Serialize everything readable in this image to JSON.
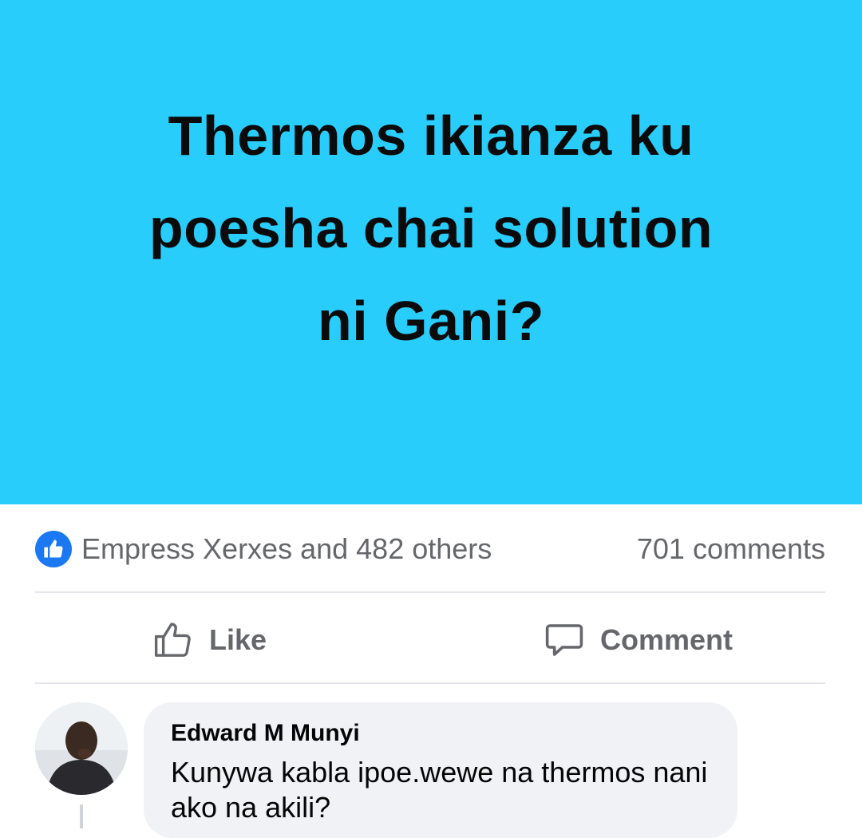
{
  "post": {
    "text_lines": [
      "Thermos ikianza ku",
      "poesha chai solution",
      "ni Gani?"
    ],
    "background_color": "#29cdfb"
  },
  "reactions": {
    "icon": "thumbs-up-icon",
    "summary": "Empress Xerxes and 482 others",
    "comment_count": "701 comments"
  },
  "actions": {
    "like_label": "Like",
    "like_icon": "thumbs-up-outline-icon",
    "comment_label": "Comment",
    "comment_icon": "speech-bubble-icon"
  },
  "comment": {
    "author": "Edward M Munyi",
    "text": "Kunywa kabla ipoe.wewe na thermos nani ako na akili?",
    "avatar_icon": "profile-photo"
  },
  "colors": {
    "accent": "#1a78f2",
    "muted_text": "#65676b",
    "bubble": "#f0f2f5"
  }
}
